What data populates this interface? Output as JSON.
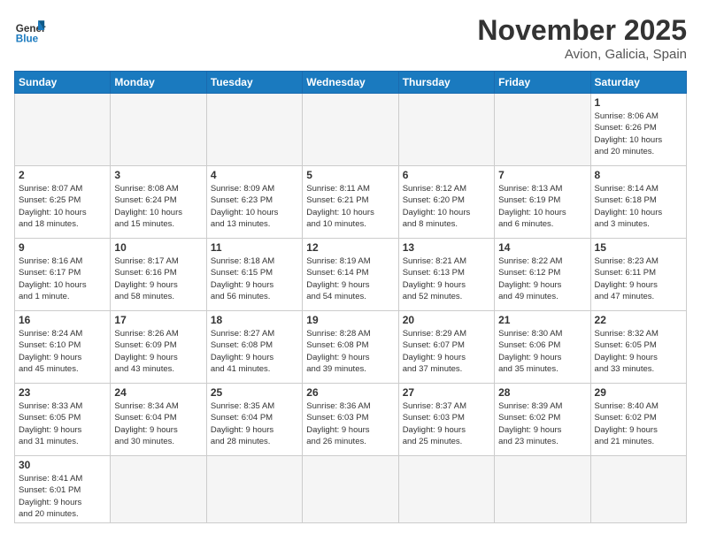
{
  "header": {
    "logo_general": "General",
    "logo_blue": "Blue",
    "month_title": "November 2025",
    "location": "Avion, Galicia, Spain"
  },
  "days_of_week": [
    "Sunday",
    "Monday",
    "Tuesday",
    "Wednesday",
    "Thursday",
    "Friday",
    "Saturday"
  ],
  "weeks": [
    [
      {
        "day": "",
        "info": ""
      },
      {
        "day": "",
        "info": ""
      },
      {
        "day": "",
        "info": ""
      },
      {
        "day": "",
        "info": ""
      },
      {
        "day": "",
        "info": ""
      },
      {
        "day": "",
        "info": ""
      },
      {
        "day": "1",
        "info": "Sunrise: 8:06 AM\nSunset: 6:26 PM\nDaylight: 10 hours\nand 20 minutes."
      }
    ],
    [
      {
        "day": "2",
        "info": "Sunrise: 8:07 AM\nSunset: 6:25 PM\nDaylight: 10 hours\nand 18 minutes."
      },
      {
        "day": "3",
        "info": "Sunrise: 8:08 AM\nSunset: 6:24 PM\nDaylight: 10 hours\nand 15 minutes."
      },
      {
        "day": "4",
        "info": "Sunrise: 8:09 AM\nSunset: 6:23 PM\nDaylight: 10 hours\nand 13 minutes."
      },
      {
        "day": "5",
        "info": "Sunrise: 8:11 AM\nSunset: 6:21 PM\nDaylight: 10 hours\nand 10 minutes."
      },
      {
        "day": "6",
        "info": "Sunrise: 8:12 AM\nSunset: 6:20 PM\nDaylight: 10 hours\nand 8 minutes."
      },
      {
        "day": "7",
        "info": "Sunrise: 8:13 AM\nSunset: 6:19 PM\nDaylight: 10 hours\nand 6 minutes."
      },
      {
        "day": "8",
        "info": "Sunrise: 8:14 AM\nSunset: 6:18 PM\nDaylight: 10 hours\nand 3 minutes."
      }
    ],
    [
      {
        "day": "9",
        "info": "Sunrise: 8:16 AM\nSunset: 6:17 PM\nDaylight: 10 hours\nand 1 minute."
      },
      {
        "day": "10",
        "info": "Sunrise: 8:17 AM\nSunset: 6:16 PM\nDaylight: 9 hours\nand 58 minutes."
      },
      {
        "day": "11",
        "info": "Sunrise: 8:18 AM\nSunset: 6:15 PM\nDaylight: 9 hours\nand 56 minutes."
      },
      {
        "day": "12",
        "info": "Sunrise: 8:19 AM\nSunset: 6:14 PM\nDaylight: 9 hours\nand 54 minutes."
      },
      {
        "day": "13",
        "info": "Sunrise: 8:21 AM\nSunset: 6:13 PM\nDaylight: 9 hours\nand 52 minutes."
      },
      {
        "day": "14",
        "info": "Sunrise: 8:22 AM\nSunset: 6:12 PM\nDaylight: 9 hours\nand 49 minutes."
      },
      {
        "day": "15",
        "info": "Sunrise: 8:23 AM\nSunset: 6:11 PM\nDaylight: 9 hours\nand 47 minutes."
      }
    ],
    [
      {
        "day": "16",
        "info": "Sunrise: 8:24 AM\nSunset: 6:10 PM\nDaylight: 9 hours\nand 45 minutes."
      },
      {
        "day": "17",
        "info": "Sunrise: 8:26 AM\nSunset: 6:09 PM\nDaylight: 9 hours\nand 43 minutes."
      },
      {
        "day": "18",
        "info": "Sunrise: 8:27 AM\nSunset: 6:08 PM\nDaylight: 9 hours\nand 41 minutes."
      },
      {
        "day": "19",
        "info": "Sunrise: 8:28 AM\nSunset: 6:08 PM\nDaylight: 9 hours\nand 39 minutes."
      },
      {
        "day": "20",
        "info": "Sunrise: 8:29 AM\nSunset: 6:07 PM\nDaylight: 9 hours\nand 37 minutes."
      },
      {
        "day": "21",
        "info": "Sunrise: 8:30 AM\nSunset: 6:06 PM\nDaylight: 9 hours\nand 35 minutes."
      },
      {
        "day": "22",
        "info": "Sunrise: 8:32 AM\nSunset: 6:05 PM\nDaylight: 9 hours\nand 33 minutes."
      }
    ],
    [
      {
        "day": "23",
        "info": "Sunrise: 8:33 AM\nSunset: 6:05 PM\nDaylight: 9 hours\nand 31 minutes."
      },
      {
        "day": "24",
        "info": "Sunrise: 8:34 AM\nSunset: 6:04 PM\nDaylight: 9 hours\nand 30 minutes."
      },
      {
        "day": "25",
        "info": "Sunrise: 8:35 AM\nSunset: 6:04 PM\nDaylight: 9 hours\nand 28 minutes."
      },
      {
        "day": "26",
        "info": "Sunrise: 8:36 AM\nSunset: 6:03 PM\nDaylight: 9 hours\nand 26 minutes."
      },
      {
        "day": "27",
        "info": "Sunrise: 8:37 AM\nSunset: 6:03 PM\nDaylight: 9 hours\nand 25 minutes."
      },
      {
        "day": "28",
        "info": "Sunrise: 8:39 AM\nSunset: 6:02 PM\nDaylight: 9 hours\nand 23 minutes."
      },
      {
        "day": "29",
        "info": "Sunrise: 8:40 AM\nSunset: 6:02 PM\nDaylight: 9 hours\nand 21 minutes."
      }
    ],
    [
      {
        "day": "30",
        "info": "Sunrise: 8:41 AM\nSunset: 6:01 PM\nDaylight: 9 hours\nand 20 minutes."
      },
      {
        "day": "",
        "info": ""
      },
      {
        "day": "",
        "info": ""
      },
      {
        "day": "",
        "info": ""
      },
      {
        "day": "",
        "info": ""
      },
      {
        "day": "",
        "info": ""
      },
      {
        "day": "",
        "info": ""
      }
    ]
  ]
}
